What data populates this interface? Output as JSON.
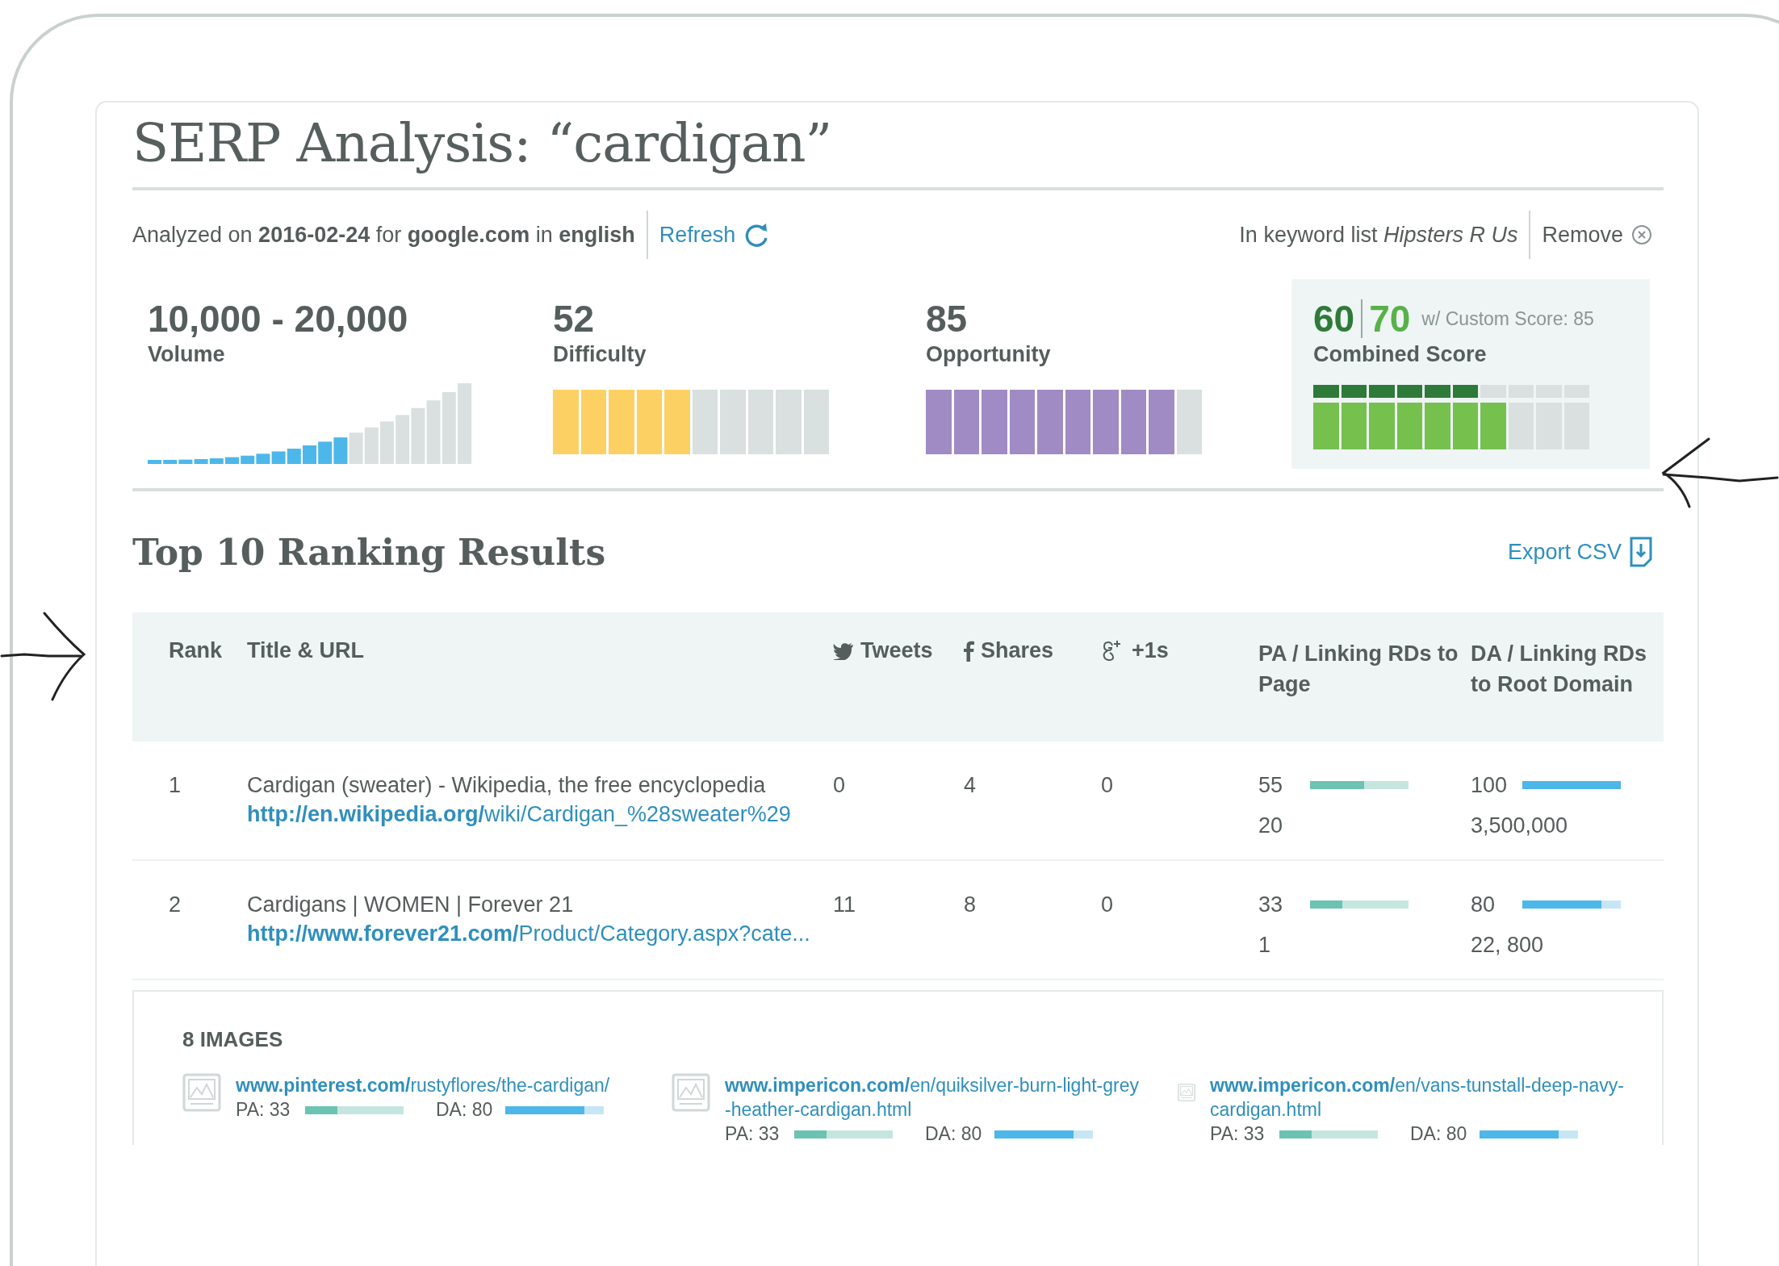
{
  "title": "SERP Analysis: “cardigan”",
  "info": {
    "analyzed": "Analyzed on **2016-02-24** for **google.com** in **english**",
    "refresh": "Refresh",
    "keyword_list": "In keyword list *Hipsters R Us*",
    "remove": "Remove"
  },
  "metrics": [
    {
      "kind": "volume",
      "value": "10,000 - 20,000",
      "label": "Volume",
      "level": 0.62
    },
    {
      "kind": "difficulty",
      "value": "52",
      "label": "Difficulty",
      "level": 0.5
    },
    {
      "kind": "opportunity",
      "value": "85",
      "label": "Opportunity",
      "level": 0.9
    }
  ],
  "combined": {
    "score": "60",
    "custom": "70",
    "custom_note": "w/ Custom Score: 85",
    "label": "Combined Score",
    "meters": [
      {
        "kind": "score",
        "level": 0.6
      },
      {
        "kind": "custom",
        "level": 0.7
      }
    ]
  },
  "results": {
    "title": "Top 10 Ranking Results",
    "export": "Export CSV",
    "columns": [
      "Rank",
      "Title & URL",
      "Tweets",
      "Shares",
      "+1s",
      "PA / Linking RDs to Page",
      "DA / Linking RDs to Root Domain"
    ],
    "rows": [
      {
        "rank": "1",
        "title": "Cardigan (sweater) - Wikipedia, the free encyclopedia",
        "url": "**http://en.wikipedia.org/**wiki/Cardigan_%28sweater%29",
        "tweets": "0",
        "shares": "4",
        "plusones": "0",
        "pa": "55",
        "pa_level": {
          "level": 0.55
        },
        "page_rds": "20",
        "da": "100",
        "da_level": {
          "level": 1
        },
        "root_rds": "3,500,000"
      },
      {
        "rank": "2",
        "title": "Cardigans | WOMEN | Forever 21",
        "url": "**http://www.forever21.com/**Product/Category.aspx?cate...",
        "tweets": "11",
        "shares": "8",
        "plusones": "0",
        "pa": "33",
        "pa_level": {
          "level": 0.33
        },
        "page_rds": "1",
        "da": "80",
        "da_level": {
          "level": 0.8
        },
        "root_rds": "22, 800"
      }
    ]
  },
  "images": {
    "title": "8 IMAGES",
    "items": [
      {
        "url": "**www.pinterest.com/**rustyflores/the-cardigan/",
        "pa": "PA: 33",
        "pa_level": {
          "level": 0.33
        },
        "da": "DA: 80",
        "da_level": {
          "level": 0.8
        }
      },
      {
        "url": "**www.impericon.com/**en/quiksilver-burn-light-grey-heather-cardigan.html",
        "pa": "PA: 33",
        "pa_level": {
          "level": 0.33
        },
        "da": "DA: 80",
        "da_level": {
          "level": 0.8
        }
      },
      {
        "url": "**www.impericon.com/**en/vans-tunstall-deep-navy-cardigan.html",
        "pa": "PA: 33",
        "pa_level": {
          "level": 0.33
        },
        "da": "DA: 80",
        "da_level": {
          "level": 0.8
        }
      }
    ]
  }
}
